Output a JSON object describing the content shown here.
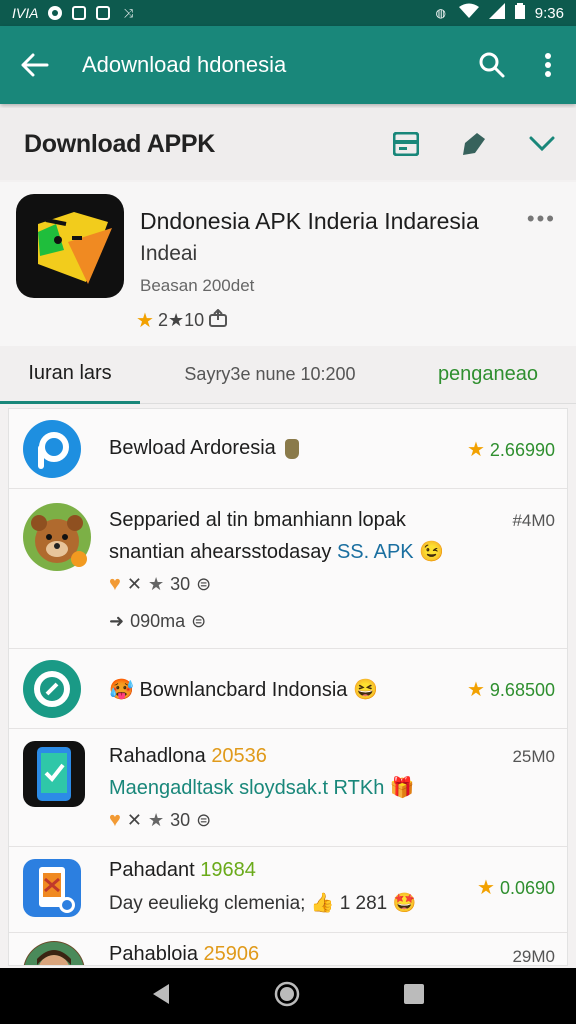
{
  "statusbar": {
    "left_text": "IVIA",
    "time": "9:36"
  },
  "toolbar": {
    "title": "Adownload hdonesia"
  },
  "section": {
    "title": "Download APPK"
  },
  "app": {
    "name": "Dndonesia APK Inderia Indaresia",
    "developer": "Indeai",
    "meta": "Beasan 200det",
    "rating": "2★10"
  },
  "tabs": [
    {
      "label": "Iuran lars"
    },
    {
      "label": "Sayry3e nune 10:200"
    },
    {
      "label": "penganeao"
    }
  ],
  "list": [
    {
      "title": "Bewload Ardoresia",
      "right": "2.66990"
    },
    {
      "title": "Sepparied al tin bmanhiann lopak",
      "sub": "snantian ahearsstodasay",
      "sub_accent": "SS. APK",
      "rating": "30",
      "extra": "090ma",
      "right": "#4M0"
    },
    {
      "title": "Bownlancbard Indonsia",
      "right": "9.68500"
    },
    {
      "title": "Rahadlona",
      "num": "20536",
      "sub": "Maengadltask sloydsak.t RTKh",
      "rating": "30",
      "right": "25M0"
    },
    {
      "title": "Pahadant",
      "num": "19684",
      "sub": "Day eeuliekg clemenia;",
      "sub_num": "1 281",
      "right": "0.0690"
    },
    {
      "title": "Pahabloia",
      "num": "25906",
      "right": "29M0"
    }
  ],
  "colors": {
    "statusbar": "#0d5a4e",
    "toolbar": "#19877a",
    "accent_star": "#f2a100",
    "green_text": "#2f8f2f"
  }
}
